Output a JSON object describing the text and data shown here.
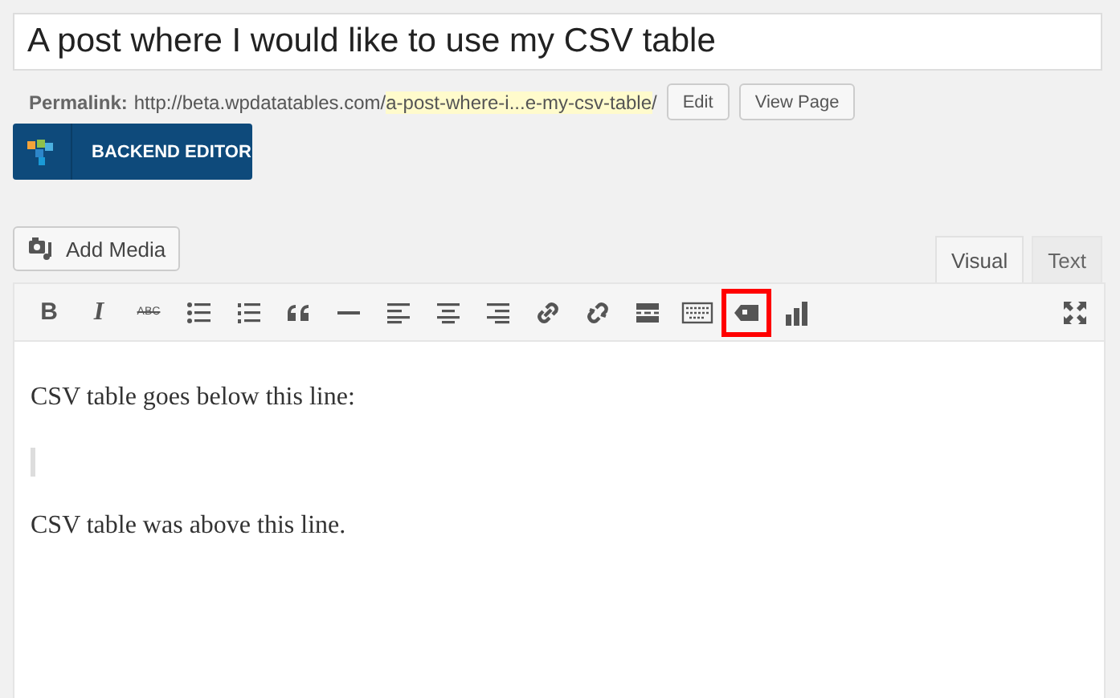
{
  "title": {
    "value": "A post where I would like to use my CSV table"
  },
  "permalink": {
    "label": "Permalink:",
    "base": "http://beta.wpdatatables.com/",
    "slug": "a-post-where-i...e-my-csv-table",
    "trail": "/",
    "buttons": [
      "Edit",
      "View Page"
    ]
  },
  "backend_editor": {
    "label": "BACKEND EDITOR"
  },
  "add_media": {
    "label": "Add Media"
  },
  "tabs": [
    {
      "label": "Visual",
      "selected": true
    },
    {
      "label": "Text",
      "selected": false
    }
  ],
  "toolbar": [
    {
      "kind": "bold",
      "label": "B",
      "highlighted": false
    },
    {
      "kind": "italic",
      "label": "I",
      "highlighted": false
    },
    {
      "kind": "strike",
      "label": "ABC",
      "highlighted": false
    },
    {
      "kind": "ul",
      "highlighted": false
    },
    {
      "kind": "ol",
      "highlighted": false
    },
    {
      "kind": "quote",
      "highlighted": false
    },
    {
      "kind": "hr",
      "highlighted": false
    },
    {
      "kind": "alignleft",
      "highlighted": false
    },
    {
      "kind": "aligncenter",
      "highlighted": false
    },
    {
      "kind": "alignright",
      "highlighted": false
    },
    {
      "kind": "link",
      "highlighted": false
    },
    {
      "kind": "unlink",
      "highlighted": false
    },
    {
      "kind": "more",
      "highlighted": false
    },
    {
      "kind": "keyboard",
      "highlighted": false
    },
    {
      "kind": "tag",
      "highlighted": true
    },
    {
      "kind": "chart",
      "highlighted": false
    }
  ],
  "content": [
    {
      "kind": "text",
      "text": "CSV table goes below this line:"
    },
    {
      "kind": "placeholder"
    },
    {
      "kind": "text",
      "text": "CSV table was above this line."
    }
  ]
}
